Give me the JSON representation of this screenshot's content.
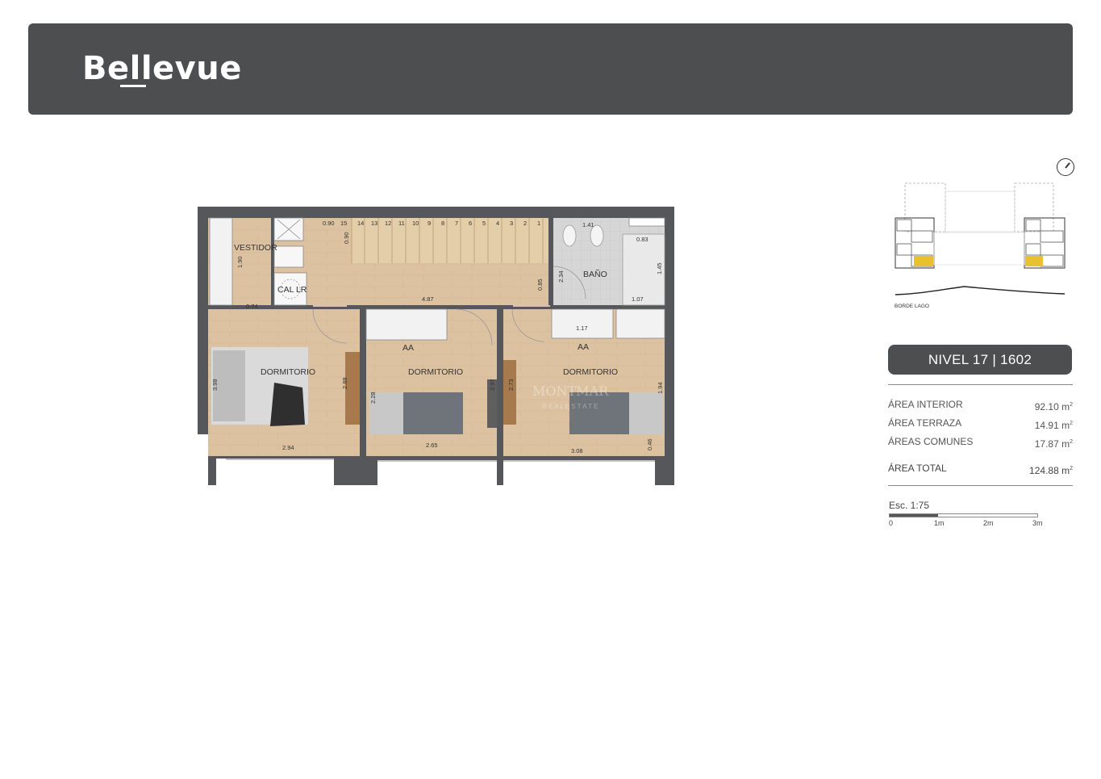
{
  "brand": {
    "name": "Bellevue"
  },
  "plan": {
    "rooms": {
      "vestidor": "VESTIDOR",
      "cal_lr": "CAL LR",
      "bano": "BAÑO",
      "dorm1": "DORMITORIO",
      "dorm2": "DORMITORIO",
      "dorm3": "DORMITORIO",
      "aa1": "AA",
      "aa2": "AA"
    },
    "stairs": [
      "15",
      "14",
      "13",
      "12",
      "11",
      "10",
      "9",
      "8",
      "7",
      "6",
      "5",
      "4",
      "3",
      "2",
      "1"
    ],
    "dims": {
      "d090a": "0.90",
      "d090b": "0.90",
      "d141": "1.41",
      "d083": "0.83",
      "d145": "1.45",
      "d190": "1.90",
      "d085": "0.85",
      "d234": "2.34",
      "d487": "4.87",
      "d074": "0.74",
      "d107": "1.07",
      "d117": "1.17",
      "d288": "2.88",
      "d228": "2.28",
      "d297": "2.97",
      "d273": "2.73",
      "d194": "1.94",
      "d294": "2.94",
      "d265": "2.65",
      "d308": "3.08",
      "d046": "0.46",
      "d398": "3.98"
    },
    "watermark": {
      "line1": "MONTMAR",
      "line2": "R E A L   E S T A T E"
    }
  },
  "site": {
    "caption": "BORDE LAGO",
    "highlight_color": "#e8c12f"
  },
  "unit": {
    "label": "NIVEL 17 | 1602"
  },
  "areas": [
    {
      "label": "ÁREA INTERIOR",
      "value": "92.10 m",
      "unit_sup": "2"
    },
    {
      "label": "ÁREA TERRAZA",
      "value": "14.91 m",
      "unit_sup": "2"
    },
    {
      "label": "ÁREAS COMUNES",
      "value": "17.87 m",
      "unit_sup": "2"
    }
  ],
  "total": {
    "label": "ÁREA TOTAL",
    "value": "124.88 m",
    "unit_sup": "2"
  },
  "scale": {
    "label": "Esc. 1:75",
    "ticks": [
      "0",
      "1m",
      "2m",
      "3m"
    ]
  },
  "colors": {
    "header": "#4d4e50",
    "floor": "#dcc2a1",
    "wall": "#55575a",
    "tile": "#cfcfcf"
  }
}
